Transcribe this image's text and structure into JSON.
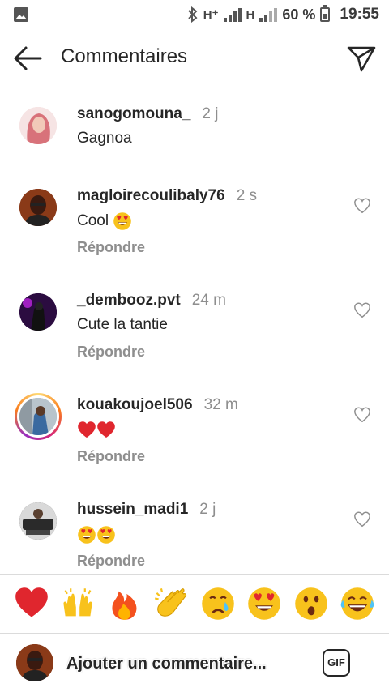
{
  "status_bar": {
    "network_1": "H⁺",
    "network_2": "H",
    "battery_percent": "60 %",
    "battery_level": 0.6,
    "time": "19:55"
  },
  "header": {
    "title": "Commentaires",
    "back_icon": "arrow-left-icon",
    "send_icon": "paper-plane-icon"
  },
  "caption": {
    "username": "sanogomouna_",
    "time": "2 j",
    "text": "Gagnoa"
  },
  "comments": [
    {
      "username": "magloirecoulibaly76",
      "time": "2 s",
      "text": "Cool",
      "emojis": [
        "heart-eyes"
      ],
      "reply": "Répondre"
    },
    {
      "username": "_dembooz.pvt",
      "time": "24 m",
      "text": "Cute la tantie",
      "emojis": [],
      "reply": "Répondre"
    },
    {
      "username": "kouakoujoel506",
      "time": "32 m",
      "text": "",
      "emojis": [
        "red-heart",
        "red-heart"
      ],
      "reply": "Répondre"
    },
    {
      "username": "hussein_madi1",
      "time": "2 j",
      "text": "",
      "emojis": [
        "heart-eyes",
        "heart-eyes"
      ],
      "reply": "Répondre"
    }
  ],
  "reactions": [
    "red-heart",
    "raising-hands",
    "fire",
    "clapping-hands",
    "crying-face",
    "heart-eyes",
    "astonished-face",
    "tears-of-joy"
  ],
  "input": {
    "placeholder": "Ajouter un commentaire...",
    "gif_label": "GIF"
  },
  "colors": {
    "text": "#262626",
    "muted": "#8e8e8e",
    "divider": "#dbdbdb",
    "heart_red": "#e0262e",
    "emoji_yellow": "#f8c21c"
  }
}
